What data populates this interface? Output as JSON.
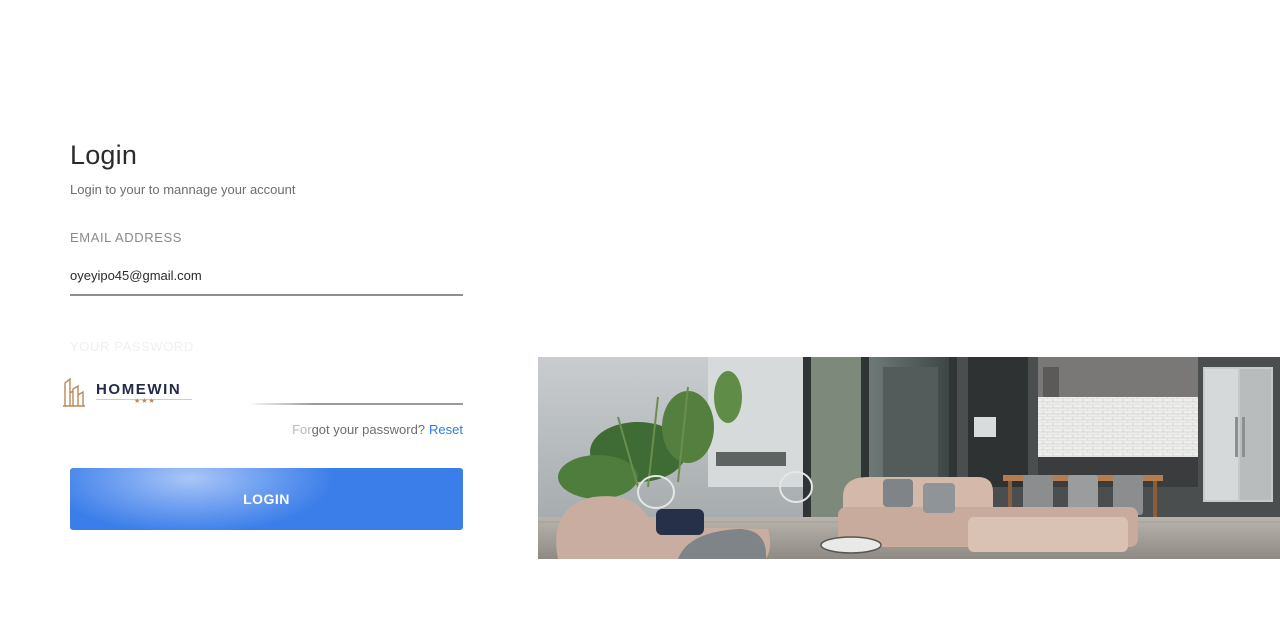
{
  "form": {
    "title": "Login",
    "subtitle": "Login to your to mannage your account",
    "email_label": "EMAIL ADDRESS",
    "email_value": "oyeyipo45@gmail.com",
    "password_label": "YOUR PASSWORD",
    "password_value": "",
    "forgot_prefix_faded": "For",
    "forgot_prefix": "got your password?",
    "reset_label": "Reset",
    "login_label": "LOGIN"
  },
  "logo": {
    "name": "HOMEWIN",
    "stars": "★★★",
    "icon": "building-logo-icon"
  },
  "hero": {
    "alt": "modern-living-room-kitchen-photo"
  },
  "colors": {
    "accent": "#3b7ee9",
    "link": "#2f7ae5",
    "logo_navy": "#232a4a",
    "logo_gold": "#b8895a"
  }
}
